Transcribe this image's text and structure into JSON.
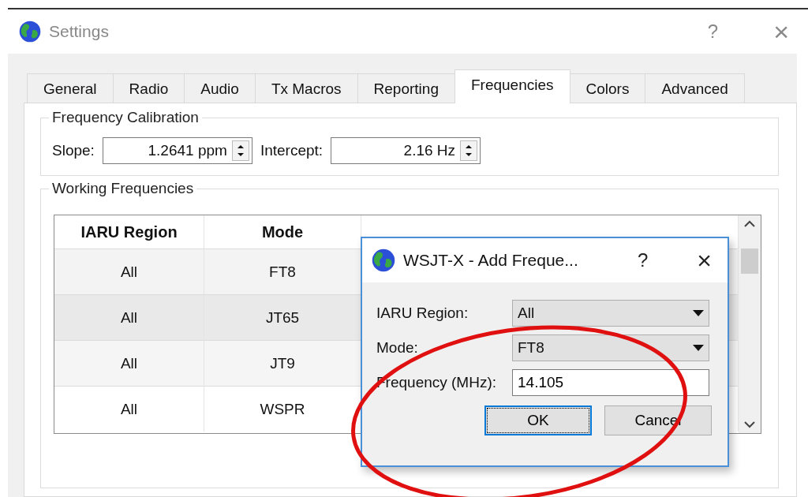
{
  "window": {
    "title": "Settings",
    "help": "?",
    "close": "×"
  },
  "tabs": [
    {
      "label": "General",
      "selected": false
    },
    {
      "label": "Radio",
      "selected": false
    },
    {
      "label": "Audio",
      "selected": false
    },
    {
      "label": "Tx Macros",
      "selected": false
    },
    {
      "label": "Reporting",
      "selected": false
    },
    {
      "label": "Frequencies",
      "selected": true
    },
    {
      "label": "Colors",
      "selected": false
    },
    {
      "label": "Advanced",
      "selected": false
    }
  ],
  "calibration": {
    "title": "Frequency Calibration",
    "fields": [
      {
        "label": "Slope:",
        "value": "1.2641 ppm"
      },
      {
        "label": "Intercept:",
        "value": "2.16 Hz"
      }
    ]
  },
  "working": {
    "title": "Working Frequencies",
    "table": {
      "columns": [
        "IARU Region",
        "Mode"
      ],
      "rows": [
        {
          "cells": [
            "All",
            "FT8"
          ]
        },
        {
          "cells": [
            "All",
            "JT65"
          ]
        },
        {
          "cells": [
            "All",
            "JT9"
          ]
        },
        {
          "cells": [
            "All",
            "WSPR"
          ]
        }
      ]
    }
  },
  "dialog": {
    "title": "WSJT-X - Add Freque...",
    "help": "?",
    "close": "×",
    "fields": [
      {
        "kind": "dropdown",
        "label": "IARU Region:",
        "value": "All"
      },
      {
        "kind": "dropdown",
        "label": "Mode:",
        "value": "FT8"
      },
      {
        "kind": "text",
        "label": "Frequency (MHz):",
        "value": "14.105"
      }
    ],
    "buttons": [
      {
        "label": "OK",
        "selected": true
      },
      {
        "label": "Cancel",
        "selected": false
      }
    ]
  }
}
